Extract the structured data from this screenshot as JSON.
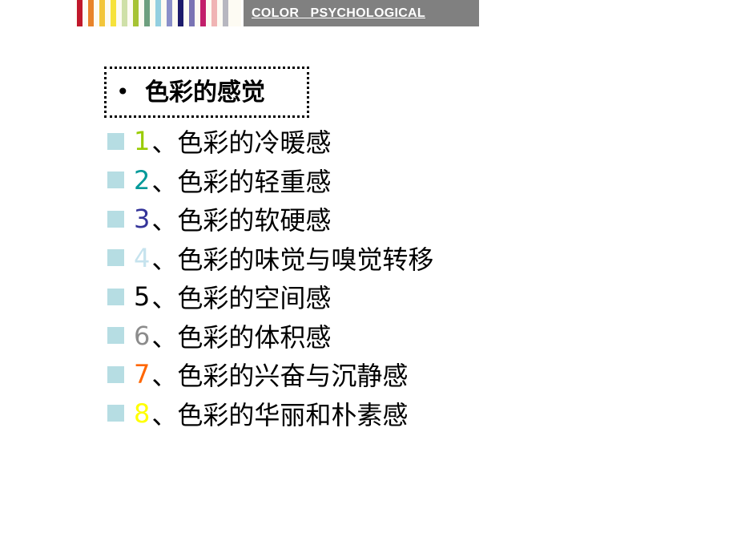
{
  "header": {
    "stripe_colors": [
      "#c0172b",
      "#e8832a",
      "#f2c53a",
      "#f6e23a",
      "#cfe0a8",
      "#a6c334",
      "#6e9f7e",
      "#93cfe0",
      "#8a8fc9",
      "#1c1b6b",
      "#7a74b4",
      "#c21f6a",
      "#f0b4b4",
      "#b7b7c0"
    ],
    "banner_text": "COLOR   PSYCHOLOGICAL"
  },
  "title": {
    "bullet": "•",
    "text": "色彩的感觉"
  },
  "items": [
    {
      "num": "1",
      "num_color": "#99cc00",
      "sep": "、",
      "text": "色彩的冷暖感"
    },
    {
      "num": "2",
      "num_color": "#009999",
      "sep": "、",
      "text": "色彩的轻重感"
    },
    {
      "num": "3",
      "num_color": "#333399",
      "sep": "、",
      "text": "色彩的软硬感"
    },
    {
      "num": "4",
      "num_color": "#c6e3ee",
      "sep": "、",
      "text": "色彩的味觉与嗅觉转移"
    },
    {
      "num": "5",
      "num_color": "#000000",
      "sep": "、",
      "text": "色彩的空间感"
    },
    {
      "num": "6",
      "num_color": "#8c8c8c",
      "sep": "、",
      "text": "色彩的体积感"
    },
    {
      "num": "7",
      "num_color": "#ff6600",
      "sep": "、",
      "text": "色彩的兴奋与沉静感"
    },
    {
      "num": "8",
      "num_color": "#ffff00",
      "sep": "、",
      "text": "色彩的华丽和朴素感"
    }
  ],
  "colors": {
    "bullet_square": "#b6dde3",
    "banner_bg": "#808080"
  }
}
